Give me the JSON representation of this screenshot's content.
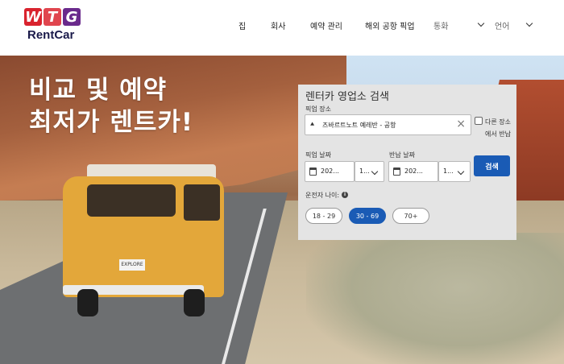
{
  "logo": {
    "letters": [
      "W",
      "T",
      "G"
    ],
    "brand": "RentCar"
  },
  "nav": {
    "items": [
      "집",
      "회사",
      "예약 관리",
      "해외 공항 픽업"
    ],
    "currency_label": "통화",
    "language_label": "언어"
  },
  "hero": {
    "headline_line1": "비교 및 예약",
    "headline_line2": "최저가 렌트카!",
    "van_plate": "EXPLORE"
  },
  "search": {
    "title": "렌터카 영업소 검색",
    "pickup_location_label": "픽업 장소",
    "pickup_location_value": "즈바르트노트 예레반 - 공항",
    "return_other_label": "다른 장소에서 반납",
    "pickup_date_label": "픽업 날짜",
    "pickup_date_value": "202...",
    "pickup_time_value": "1...",
    "return_date_label": "반납 날짜",
    "return_date_value": "202...",
    "return_time_value": "1...",
    "search_button": "검색",
    "driver_age_label": "운전자 나이:",
    "age_options": [
      "18 - 29",
      "30 - 69",
      "70+"
    ],
    "selected_age": "30 - 69"
  },
  "colors": {
    "primary": "#1a5bb5",
    "panel_bg": "#e4e4e4"
  }
}
